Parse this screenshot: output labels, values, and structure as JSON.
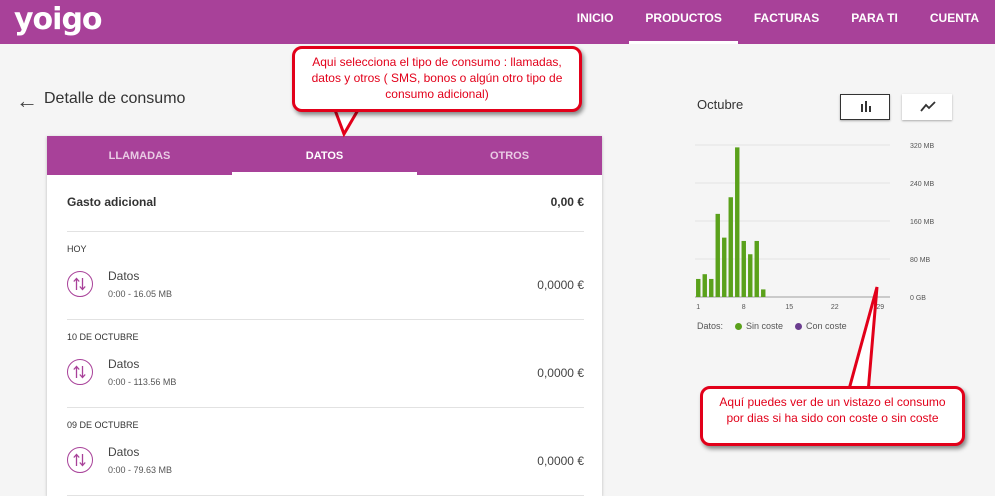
{
  "header": {
    "logo": "yoigo",
    "nav": [
      "INICIO",
      "PRODUCTOS",
      "FACTURAS",
      "PARA TI",
      "CUENTA"
    ],
    "active_nav": "PRODUCTOS"
  },
  "page": {
    "title": "Detalle de consumo",
    "tabs": [
      "LLAMADAS",
      "DATOS",
      "OTROS"
    ],
    "active_tab": "DATOS",
    "gasto": {
      "label": "Gasto adicional",
      "value": "0,00 €"
    },
    "days": [
      {
        "date": "HOY",
        "name": "Datos",
        "detail": "0:00 - 16.05 MB",
        "value": "0,0000 €"
      },
      {
        "date": "10 DE OCTUBRE",
        "name": "Datos",
        "detail": "0:00 - 113.56 MB",
        "value": "0,0000 €"
      },
      {
        "date": "09 DE OCTUBRE",
        "name": "Datos",
        "detail": "0:00 - 79.63 MB",
        "value": "0,0000 €"
      }
    ]
  },
  "chart_panel": {
    "month": "Octubre",
    "buttons": [
      "bar-chart-icon",
      "line-chart-icon"
    ],
    "selected_button": "bar-chart-icon"
  },
  "chart_data": {
    "type": "bar",
    "title": "Octubre",
    "y_tick_labels": [
      "320 MB",
      "240 MB",
      "160 MB",
      "80 MB",
      "0 GB"
    ],
    "y_ticks": [
      320,
      240,
      160,
      80,
      0
    ],
    "x_tick_labels": [
      "1",
      "8",
      "15",
      "22",
      "29"
    ],
    "x_ticks": [
      1,
      8,
      15,
      22,
      29
    ],
    "ylim": [
      0,
      320
    ],
    "xlim": [
      0.5,
      30.5
    ],
    "grid": true,
    "categories": [
      1,
      2,
      3,
      4,
      5,
      6,
      7,
      8,
      9,
      10,
      11,
      12,
      13,
      14,
      15,
      16,
      17,
      18,
      19,
      20,
      21,
      22,
      23,
      24,
      25,
      26,
      27,
      28,
      29,
      30
    ],
    "series": [
      {
        "name": "Sin coste",
        "color": "#5aa11b",
        "values": [
          38,
          48,
          38,
          175,
          125,
          210,
          315,
          118,
          90,
          118,
          16,
          0,
          0,
          0,
          0,
          0,
          0,
          0,
          0,
          0,
          0,
          0,
          0,
          0,
          0,
          0,
          0,
          0,
          0,
          0
        ]
      },
      {
        "name": "Con coste",
        "color": "#6b3d8f",
        "values": [
          0,
          0,
          0,
          0,
          0,
          0,
          0,
          0,
          0,
          0,
          0,
          0,
          0,
          0,
          0,
          0,
          0,
          0,
          0,
          0,
          0,
          0,
          0,
          0,
          0,
          0,
          0,
          0,
          0,
          0
        ]
      }
    ],
    "legend_title": "Datos:",
    "legend": [
      "Sin coste",
      "Con coste"
    ],
    "legend_placement": "bottom"
  },
  "annotations": {
    "top": "Aqui selecciona el tipo de consumo : llamadas, datos y otros ( SMS, bonos o algún otro tipo de consumo adicional)",
    "right": "Aquí puedes ver de un vistazo el consumo por dias si ha sido con coste o sin coste"
  },
  "colors": {
    "brand": "#a84199",
    "bar_sin_coste": "#5aa11b",
    "bar_con_coste": "#6b3d8f",
    "callout": "#e2001a"
  }
}
